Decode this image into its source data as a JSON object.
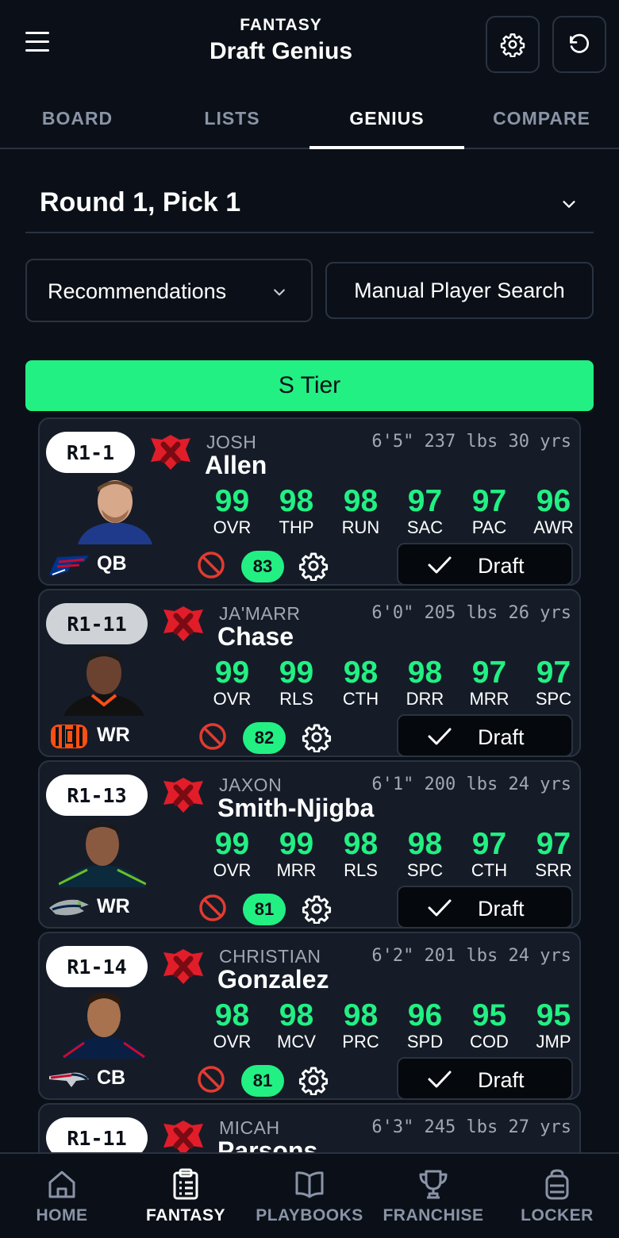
{
  "header": {
    "kicker": "FANTASY",
    "title": "Draft Genius",
    "menu_icon": "hamburger-icon",
    "settings_icon": "gear-icon",
    "reset_icon": "reset-icon"
  },
  "tabs": [
    {
      "label": "BOARD",
      "active": false
    },
    {
      "label": "LISTS",
      "active": false
    },
    {
      "label": "GENIUS",
      "active": true
    },
    {
      "label": "COMPARE",
      "active": false
    }
  ],
  "round_select": {
    "value": "Round 1, Pick 1"
  },
  "mode_select": {
    "value": "Recommendations"
  },
  "search_button": {
    "label": "Manual Player Search"
  },
  "tier": {
    "label": "S Tier",
    "color": "#22f083"
  },
  "colors": {
    "accent": "#22f083",
    "card": "#151c28",
    "border": "#2a3340",
    "ban": "#e23b30",
    "brand": "#e11d2a"
  },
  "draft_label": "Draft",
  "players": [
    {
      "pick": "R1-1",
      "first": "JOSH",
      "last": "Allen",
      "bio": "6'5\" 237 lbs 30 yrs",
      "team": "bills",
      "pos": "QB",
      "rating": "83",
      "stats": [
        {
          "v": "99",
          "l": "OVR"
        },
        {
          "v": "98",
          "l": "THP"
        },
        {
          "v": "98",
          "l": "RUN"
        },
        {
          "v": "97",
          "l": "SAC"
        },
        {
          "v": "97",
          "l": "PAC"
        },
        {
          "v": "96",
          "l": "AWR"
        }
      ]
    },
    {
      "pick": "R1-11",
      "first": "JA'MARR",
      "last": "Chase",
      "bio": "6'0\" 205 lbs 26 yrs",
      "team": "bengals",
      "pos": "WR",
      "rating": "82",
      "stats": [
        {
          "v": "99",
          "l": "OVR"
        },
        {
          "v": "99",
          "l": "RLS"
        },
        {
          "v": "98",
          "l": "CTH"
        },
        {
          "v": "98",
          "l": "DRR"
        },
        {
          "v": "97",
          "l": "MRR"
        },
        {
          "v": "97",
          "l": "SPC"
        }
      ]
    },
    {
      "pick": "R1-13",
      "first": "JAXON",
      "last": "Smith-Njigba",
      "bio": "6'1\" 200 lbs 24 yrs",
      "team": "seahawks",
      "pos": "WR",
      "rating": "81",
      "stats": [
        {
          "v": "99",
          "l": "OVR"
        },
        {
          "v": "99",
          "l": "MRR"
        },
        {
          "v": "98",
          "l": "RLS"
        },
        {
          "v": "98",
          "l": "SPC"
        },
        {
          "v": "97",
          "l": "CTH"
        },
        {
          "v": "97",
          "l": "SRR"
        }
      ]
    },
    {
      "pick": "R1-14",
      "first": "CHRISTIAN",
      "last": "Gonzalez",
      "bio": "6'2\" 201 lbs 24 yrs",
      "team": "patriots",
      "pos": "CB",
      "rating": "81",
      "stats": [
        {
          "v": "98",
          "l": "OVR"
        },
        {
          "v": "98",
          "l": "MCV"
        },
        {
          "v": "98",
          "l": "PRC"
        },
        {
          "v": "96",
          "l": "SPD"
        },
        {
          "v": "95",
          "l": "COD"
        },
        {
          "v": "95",
          "l": "JMP"
        }
      ]
    },
    {
      "pick": "R1-11",
      "first": "MICAH",
      "last": "Parsons",
      "bio": "6'3\" 245 lbs 27 yrs",
      "team": "",
      "pos": "",
      "rating": "",
      "stats": []
    }
  ],
  "bottom_nav": [
    {
      "label": "HOME",
      "icon": "home-icon",
      "active": false
    },
    {
      "label": "FANTASY",
      "icon": "clipboard-icon",
      "active": true
    },
    {
      "label": "PLAYBOOKS",
      "icon": "book-icon",
      "active": false
    },
    {
      "label": "FRANCHISE",
      "icon": "trophy-icon",
      "active": false
    },
    {
      "label": "LOCKER",
      "icon": "locker-icon",
      "active": false
    }
  ]
}
